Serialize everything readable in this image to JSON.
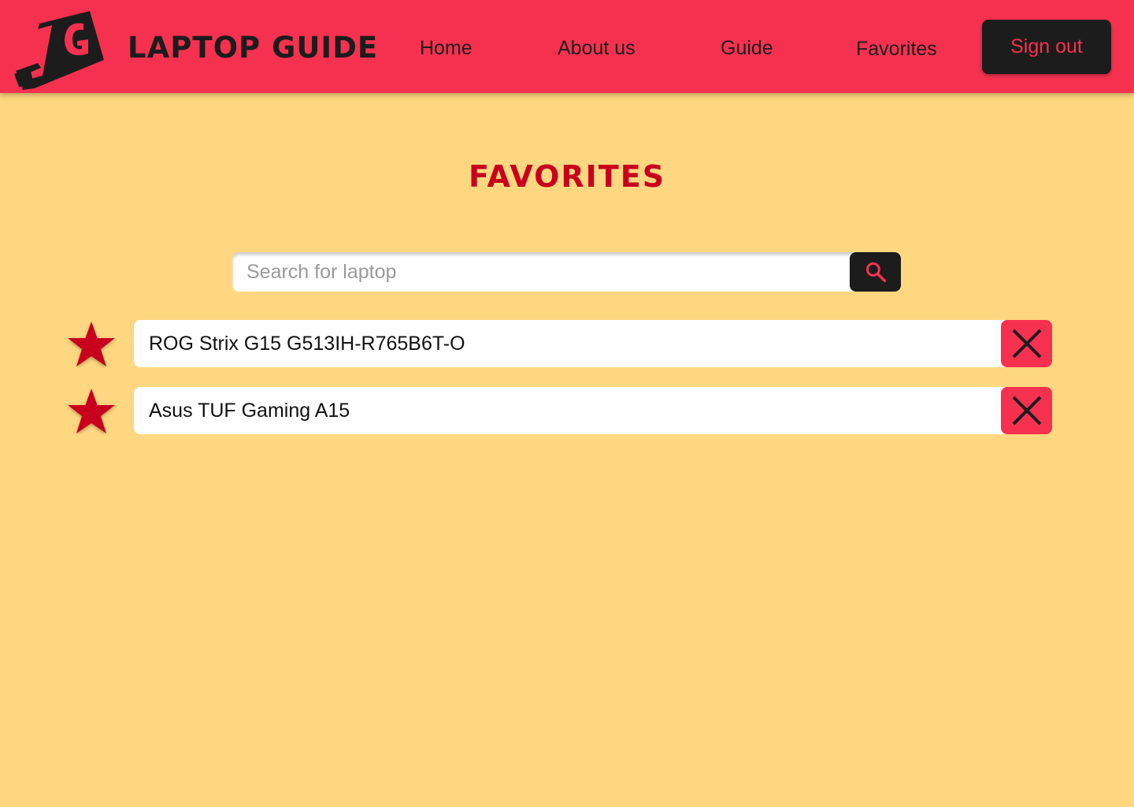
{
  "header": {
    "brand": "Laptop Guide",
    "logo_icon": "lg-logo-icon",
    "nav": [
      {
        "label": "Home"
      },
      {
        "label": "About us"
      },
      {
        "label": "Guide"
      },
      {
        "label": "Favorites"
      }
    ],
    "signout_label": "Sign out"
  },
  "main": {
    "title": "Favorites",
    "search": {
      "placeholder": "Search for laptop",
      "value": "",
      "button_icon": "search-icon"
    },
    "favorites": [
      {
        "name": "ROG Strix G15 G513IH-R765B6T-O",
        "icon": "star-icon",
        "remove_icon": "close-icon"
      },
      {
        "name": "Asus TUF Gaming A15",
        "icon": "star-icon",
        "remove_icon": "close-icon"
      }
    ]
  },
  "colors": {
    "header_bg": "#F63150",
    "page_bg": "#FFD780",
    "accent_dark": "#1C1C1C",
    "title_red": "#C8001E",
    "star_red": "#C8001E"
  }
}
